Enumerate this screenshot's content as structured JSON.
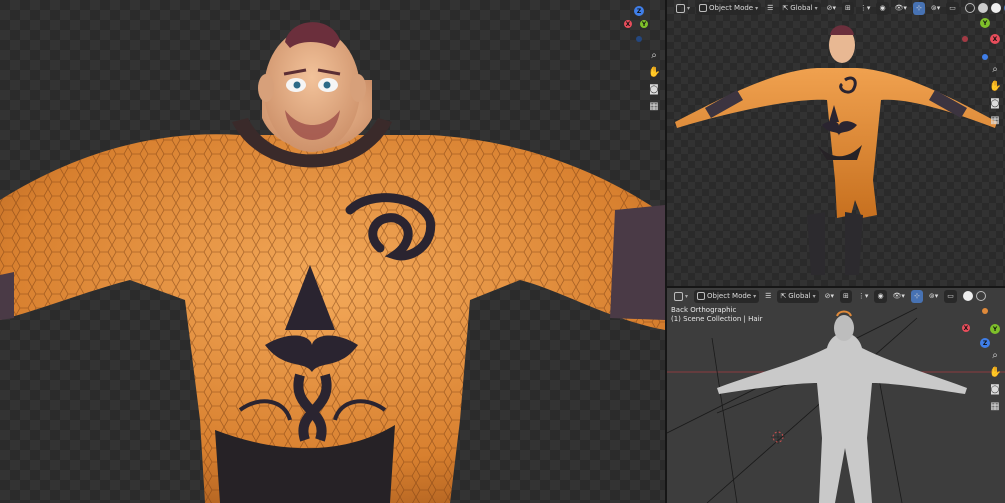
{
  "top_viewport": {
    "mode_label": "Object Mode",
    "orientation_label": "Global",
    "gizmo": {
      "x": "X",
      "y": "Y",
      "z": "Z"
    }
  },
  "bottom_viewport": {
    "mode_label": "Object Mode",
    "orientation_label": "Global",
    "view_name": "Back Orthographic",
    "collection_info": "(1) Scene Collection | Hair",
    "gizmo": {
      "x": "X",
      "y": "Y",
      "z": "Z"
    }
  },
  "main_viewport": {
    "gizmo": {
      "x": "X",
      "y": "Y",
      "z": "Z"
    }
  },
  "icons": {
    "zoom": "zoom-icon",
    "pan": "hand-icon",
    "camera": "camera-icon",
    "grid": "grid-icon"
  },
  "colors": {
    "axis_x": "#e84d5b",
    "axis_y": "#7ec02a",
    "axis_z": "#3f7ee8",
    "skin_orange": "#e08a3a",
    "accent_blue": "#4772b3"
  }
}
